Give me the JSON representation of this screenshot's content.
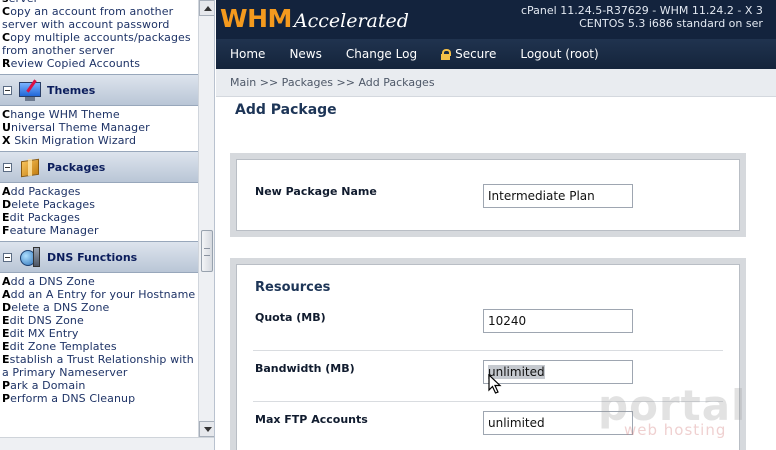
{
  "sidebar": {
    "top_links": [
      {
        "label": "server"
      },
      {
        "label": "Copy an account from another server with account password"
      },
      {
        "label": "Copy multiple accounts/packages from another server"
      },
      {
        "label": "Review Copied Accounts"
      }
    ],
    "sections": [
      {
        "title": "Themes",
        "icon": "monitor-theme-icon",
        "links": [
          {
            "label": "Change WHM Theme"
          },
          {
            "label": "Universal Theme Manager"
          },
          {
            "label": "X Skin Migration Wizard"
          }
        ]
      },
      {
        "title": "Packages",
        "icon": "package-box-icon",
        "links": [
          {
            "label": "Add Packages"
          },
          {
            "label": "Delete Packages"
          },
          {
            "label": "Edit Packages"
          },
          {
            "label": "Feature Manager"
          }
        ]
      },
      {
        "title": "DNS Functions",
        "icon": "dns-globe-icon",
        "links": [
          {
            "label": "Add a DNS Zone"
          },
          {
            "label": "Add an A Entry for your Hostname"
          },
          {
            "label": "Delete a DNS Zone"
          },
          {
            "label": "Edit DNS Zone"
          },
          {
            "label": "Edit MX Entry"
          },
          {
            "label": "Edit Zone Templates"
          },
          {
            "label": "Establish a Trust Relationship with a Primary Nameserver"
          },
          {
            "label": "Park a Domain"
          },
          {
            "label": "Perform a DNS Cleanup"
          }
        ]
      }
    ]
  },
  "header": {
    "logo_main": "WHM",
    "logo_sub": "Accelerated",
    "version_line1": "cPanel 11.24.5-R37629 - WHM 11.24.2 - X 3",
    "version_line2": "CENTOS 5.3 i686 standard on ser",
    "nav": [
      {
        "label": "Home"
      },
      {
        "label": "News"
      },
      {
        "label": "Change Log"
      },
      {
        "label": "Secure",
        "icon": "lock-icon"
      },
      {
        "label": "Logout (root)"
      }
    ]
  },
  "main": {
    "breadcrumb": "Main >> Packages >> Add Packages",
    "page_title": "Add Package",
    "package_name": {
      "label": "New Package Name",
      "value": "Intermediate Plan"
    },
    "resources": {
      "title": "Resources",
      "fields": [
        {
          "label": "Quota (MB)",
          "value": "10240"
        },
        {
          "label": "Bandwidth (MB)",
          "value": "unlimited"
        },
        {
          "label": "Max FTP Accounts",
          "value": "unlimited"
        }
      ]
    }
  },
  "watermark": {
    "main": "portal",
    "sub": "web hosting"
  },
  "colors": {
    "header_bg": "#13233d",
    "logo_orange": "#f49a1e",
    "link": "#1e3366",
    "panel_bg": "#d6d9dd"
  }
}
